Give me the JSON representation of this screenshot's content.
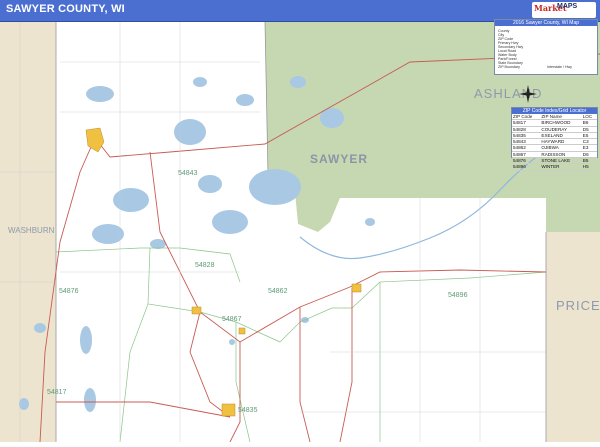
{
  "title": "SAWYER COUNTY, WI",
  "brand": {
    "line1": "Market",
    "line2": "MAPS"
  },
  "legend": {
    "title": "2016 Sawyer County, WI Map",
    "rows": [
      "County",
      "City",
      "ZIP Code",
      "Primary Hwy",
      "Secondary Hwy",
      "Local Road",
      "Water Body",
      "Park/Forest",
      "State Boundary",
      "ZIP Boundary",
      "Interstate / Hwy"
    ]
  },
  "zip_index": {
    "title": "ZIP Code Index/Grid Locator",
    "headers": [
      "ZIP Code",
      "ZIP Name",
      "LOC"
    ],
    "rows": [
      [
        "54817",
        "BIRCHWOOD",
        "B6"
      ],
      [
        "54828",
        "COUDERAY",
        "D5"
      ],
      [
        "54835",
        "EXELAND",
        "E5"
      ],
      [
        "54843",
        "HAYWARD",
        "C3"
      ],
      [
        "54862",
        "OJIBWA",
        "E3"
      ],
      [
        "54867",
        "RADISSON",
        "D6"
      ],
      [
        "54876",
        "STONE LAKE",
        "B5"
      ],
      [
        "54896",
        "WINTER",
        "H5"
      ]
    ]
  },
  "labels": {
    "county_main": "SAWYER",
    "ashland": "ASHLAND",
    "washburn": "WASHBURN",
    "price": "PRICE"
  },
  "zips": [
    "54843",
    "54828",
    "54862",
    "54867",
    "54896",
    "54876",
    "54835",
    "54817"
  ]
}
